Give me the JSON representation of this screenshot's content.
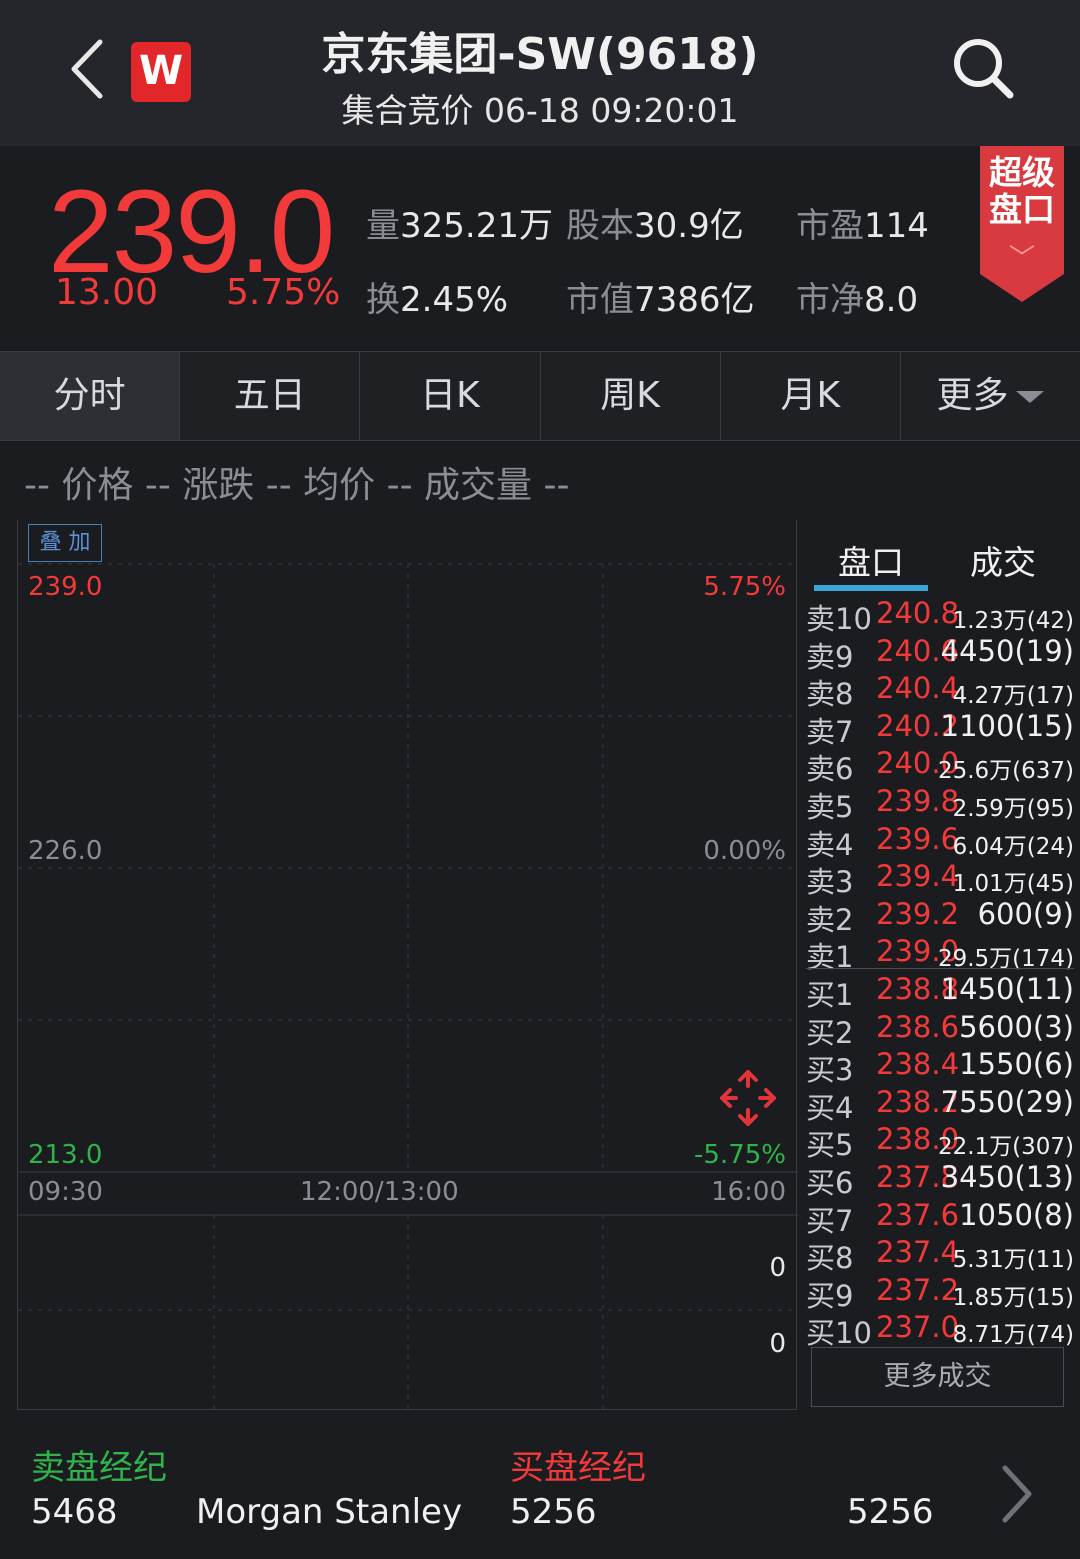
{
  "header": {
    "title": "京东集团-SW(9618)",
    "subtitle": "集合竞价 06-18 09:20:01",
    "logo_text": "W"
  },
  "quote": {
    "price": "239.0",
    "change": "13.00",
    "change_pct": "5.75%",
    "volume_label": "量",
    "volume": "325.21万",
    "share_cap_label": "股本",
    "share_cap": "30.9亿",
    "pe_label": "市盈",
    "pe": "114",
    "turnover_label": "换",
    "turnover": "2.45%",
    "mkt_cap_label": "市值",
    "mkt_cap": "7386亿",
    "pb_label": "市净",
    "pb": "8.0",
    "super_book_label_1": "超级",
    "super_book_label_2": "盘口"
  },
  "tabs": [
    "分时",
    "五日",
    "日K",
    "周K",
    "月K",
    "更多"
  ],
  "legend": "-- 价格 -- 涨跌 -- 均价 -- 成交量 --",
  "chart": {
    "overlay_label": "叠 加",
    "y_top": "239.0",
    "y_mid": "226.0",
    "y_bottom": "213.0",
    "pct_top": "5.75%",
    "pct_mid": "0.00%",
    "pct_bottom": "-5.75%",
    "x_start": "09:30",
    "x_mid": "12:00/13:00",
    "x_end": "16:00",
    "vol_top": "0",
    "vol_bottom": "0"
  },
  "orderbook": {
    "tab_book": "盘口",
    "tab_trades": "成交",
    "asks": [
      {
        "label": "卖10",
        "price": "240.8",
        "vol": "1.23万(42)"
      },
      {
        "label": "卖9",
        "price": "240.6",
        "vol": "4450(19)"
      },
      {
        "label": "卖8",
        "price": "240.4",
        "vol": "4.27万(17)"
      },
      {
        "label": "卖7",
        "price": "240.2",
        "vol": "1100(15)"
      },
      {
        "label": "卖6",
        "price": "240.0",
        "vol": "25.6万(637)"
      },
      {
        "label": "卖5",
        "price": "239.8",
        "vol": "2.59万(95)"
      },
      {
        "label": "卖4",
        "price": "239.6",
        "vol": "6.04万(24)"
      },
      {
        "label": "卖3",
        "price": "239.4",
        "vol": "1.01万(45)"
      },
      {
        "label": "卖2",
        "price": "239.2",
        "vol": "600(9)"
      },
      {
        "label": "卖1",
        "price": "239.0",
        "vol": "29.5万(174)"
      }
    ],
    "bids": [
      {
        "label": "买1",
        "price": "238.8",
        "vol": "1450(11)"
      },
      {
        "label": "买2",
        "price": "238.6",
        "vol": "5600(3)"
      },
      {
        "label": "买3",
        "price": "238.4",
        "vol": "1550(6)"
      },
      {
        "label": "买4",
        "price": "238.2",
        "vol": "7550(29)"
      },
      {
        "label": "买5",
        "price": "238.0",
        "vol": "22.1万(307)"
      },
      {
        "label": "买6",
        "price": "237.8",
        "vol": "3450(13)"
      },
      {
        "label": "买7",
        "price": "237.6",
        "vol": "1050(8)"
      },
      {
        "label": "买8",
        "price": "237.4",
        "vol": "5.31万(11)"
      },
      {
        "label": "买9",
        "price": "237.2",
        "vol": "1.85万(15)"
      },
      {
        "label": "买10",
        "price": "237.0",
        "vol": "8.71万(74)"
      }
    ],
    "more_trades": "更多成交"
  },
  "brokers": {
    "sell_title": "卖盘经纪",
    "sell_id": "5468",
    "sell_name": "Morgan Stanley",
    "buy_title": "买盘经纪",
    "buy_id": "5256",
    "buy_id2": "5256"
  },
  "colors": {
    "up": "#f23a3a",
    "down": "#2fb34a",
    "accent": "#3aa6d8",
    "background": "#1b1c20"
  }
}
